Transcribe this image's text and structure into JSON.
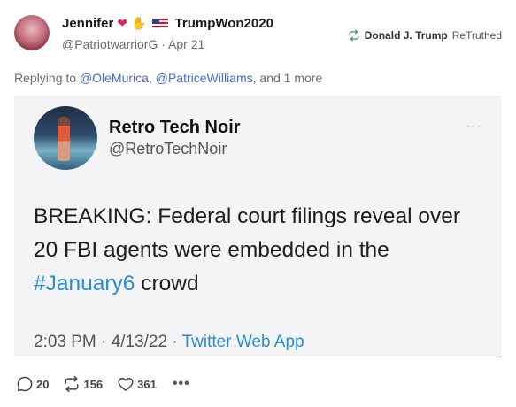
{
  "post": {
    "author_name": "Jennifer",
    "author_suffix": "TrumpWon2020",
    "handle": "@PatriotwarriorG",
    "separator": "·",
    "date": "Apr 21",
    "retruth_by": "Donald J. Trump",
    "retruth_label": "ReTruthed",
    "replying_prefix": "Replying to",
    "mentions": [
      "@OleMurica",
      "@PatriceWilliams"
    ],
    "replying_comma": ",",
    "replying_suffix": ", and 1 more"
  },
  "embed": {
    "name": "Retro Tech Noir",
    "handle": "@RetroTechNoir",
    "more": "···",
    "text_main": "BREAKING: Federal court filings reveal over 20 FBI agents were embedded in the ",
    "hashtag": "#January6",
    "text_end": " crowd",
    "time": "2:03 PM",
    "dot": "·",
    "date": "4/13/22",
    "app": "Twitter Web App"
  },
  "actions": {
    "replies": "20",
    "retruths": "156",
    "likes": "361",
    "more": "•••"
  },
  "colors": {
    "mention": "#4b68c9",
    "hashtag": "#2a8bd6",
    "retruth_icon": "#2e9e5a"
  }
}
